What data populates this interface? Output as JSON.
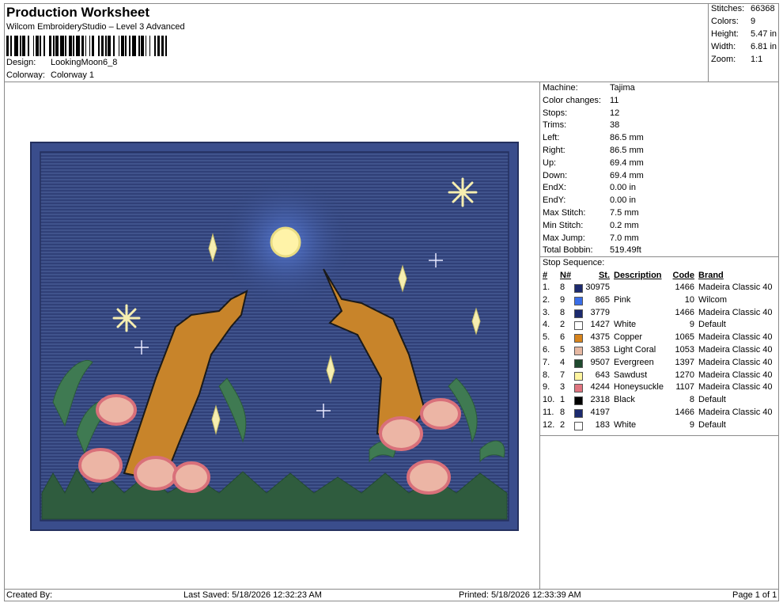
{
  "header": {
    "title": "Production Worksheet",
    "software": "Wilcom EmbroideryStudio – Level 3 Advanced",
    "design_label": "Design:",
    "design_value": "LookingMoon6_8",
    "colorway_label": "Colorway:",
    "colorway_value": "Colorway 1"
  },
  "summary": [
    {
      "label": "Stitches:",
      "value": "66368"
    },
    {
      "label": "Colors:",
      "value": "9"
    },
    {
      "label": "Height:",
      "value": "5.47 in"
    },
    {
      "label": "Width:",
      "value": "6.81 in"
    },
    {
      "label": "Zoom:",
      "value": "1:1"
    }
  ],
  "machine": [
    {
      "label": "Machine:",
      "value": "Tajima"
    },
    {
      "label": "Color changes:",
      "value": "11"
    },
    {
      "label": "Stops:",
      "value": "12"
    },
    {
      "label": "Trims:",
      "value": "38"
    },
    {
      "label": "Left:",
      "value": "86.5 mm"
    },
    {
      "label": "Right:",
      "value": "86.5 mm"
    },
    {
      "label": "Up:",
      "value": "69.4 mm"
    },
    {
      "label": "Down:",
      "value": "69.4 mm"
    },
    {
      "label": "EndX:",
      "value": "0.00 in"
    },
    {
      "label": "EndY:",
      "value": "0.00 in"
    },
    {
      "label": "Max Stitch:",
      "value": "7.5 mm"
    },
    {
      "label": "Min Stitch:",
      "value": "0.2 mm"
    },
    {
      "label": "Max Jump:",
      "value": "7.0 mm"
    },
    {
      "label": "Total Bobbin:",
      "value": "519.49ft"
    }
  ],
  "stop_sequence": {
    "title": "Stop Sequence:",
    "headers": {
      "num": "#",
      "n": "N#",
      "st": "St.",
      "desc": "Description",
      "code": "Code",
      "brand": "Brand"
    },
    "rows": [
      {
        "num": "1.",
        "n": "8",
        "color": "#1c2a6e",
        "st": "30975",
        "desc": "",
        "code": "1466",
        "brand": "Madeira Classic 40"
      },
      {
        "num": "2.",
        "n": "9",
        "color": "#3a6ee8",
        "st": "865",
        "desc": "Pink",
        "code": "10",
        "brand": "Wilcom"
      },
      {
        "num": "3.",
        "n": "8",
        "color": "#1c2a6e",
        "st": "3779",
        "desc": "",
        "code": "1466",
        "brand": "Madeira Classic 40"
      },
      {
        "num": "4.",
        "n": "2",
        "color": "#ffffff",
        "st": "1427",
        "desc": "White",
        "code": "9",
        "brand": "Default"
      },
      {
        "num": "5.",
        "n": "6",
        "color": "#d7841c",
        "st": "4375",
        "desc": "Copper",
        "code": "1065",
        "brand": "Madeira Classic 40"
      },
      {
        "num": "6.",
        "n": "5",
        "color": "#e6b8a2",
        "st": "3853",
        "desc": "Light Coral",
        "code": "1053",
        "brand": "Madeira Classic 40"
      },
      {
        "num": "7.",
        "n": "4",
        "color": "#1f4a2e",
        "st": "9507",
        "desc": "Evergreen",
        "code": "1397",
        "brand": "Madeira Classic 40"
      },
      {
        "num": "8.",
        "n": "7",
        "color": "#fff5a0",
        "st": "643",
        "desc": "Sawdust",
        "code": "1270",
        "brand": "Madeira Classic 40"
      },
      {
        "num": "9.",
        "n": "3",
        "color": "#e07580",
        "st": "4244",
        "desc": "Honeysuckle",
        "code": "1107",
        "brand": "Madeira Classic 40"
      },
      {
        "num": "10.",
        "n": "1",
        "color": "#000000",
        "st": "2318",
        "desc": "Black",
        "code": "8",
        "brand": "Default"
      },
      {
        "num": "11.",
        "n": "8",
        "color": "#1c2a6e",
        "st": "4197",
        "desc": "",
        "code": "1466",
        "brand": "Madeira Classic 40"
      },
      {
        "num": "12.",
        "n": "2",
        "color": "#ffffff",
        "st": "183",
        "desc": "White",
        "code": "9",
        "brand": "Default"
      }
    ]
  },
  "footer": {
    "created_by": "Created By:",
    "last_saved": "Last Saved: 5/18/2026 12:32:23 AM",
    "printed": "Printed: 5/18/2026 12:33:39 AM",
    "page": "Page 1 of 1"
  },
  "colors": {
    "sky": "#2f3f7a",
    "border": "#3a4d8c",
    "hand": "#c8842a",
    "leaf": "#3f7a52",
    "flower": "#e9a29a",
    "moon": "#fff3a8",
    "star": "#f6eeb0"
  }
}
